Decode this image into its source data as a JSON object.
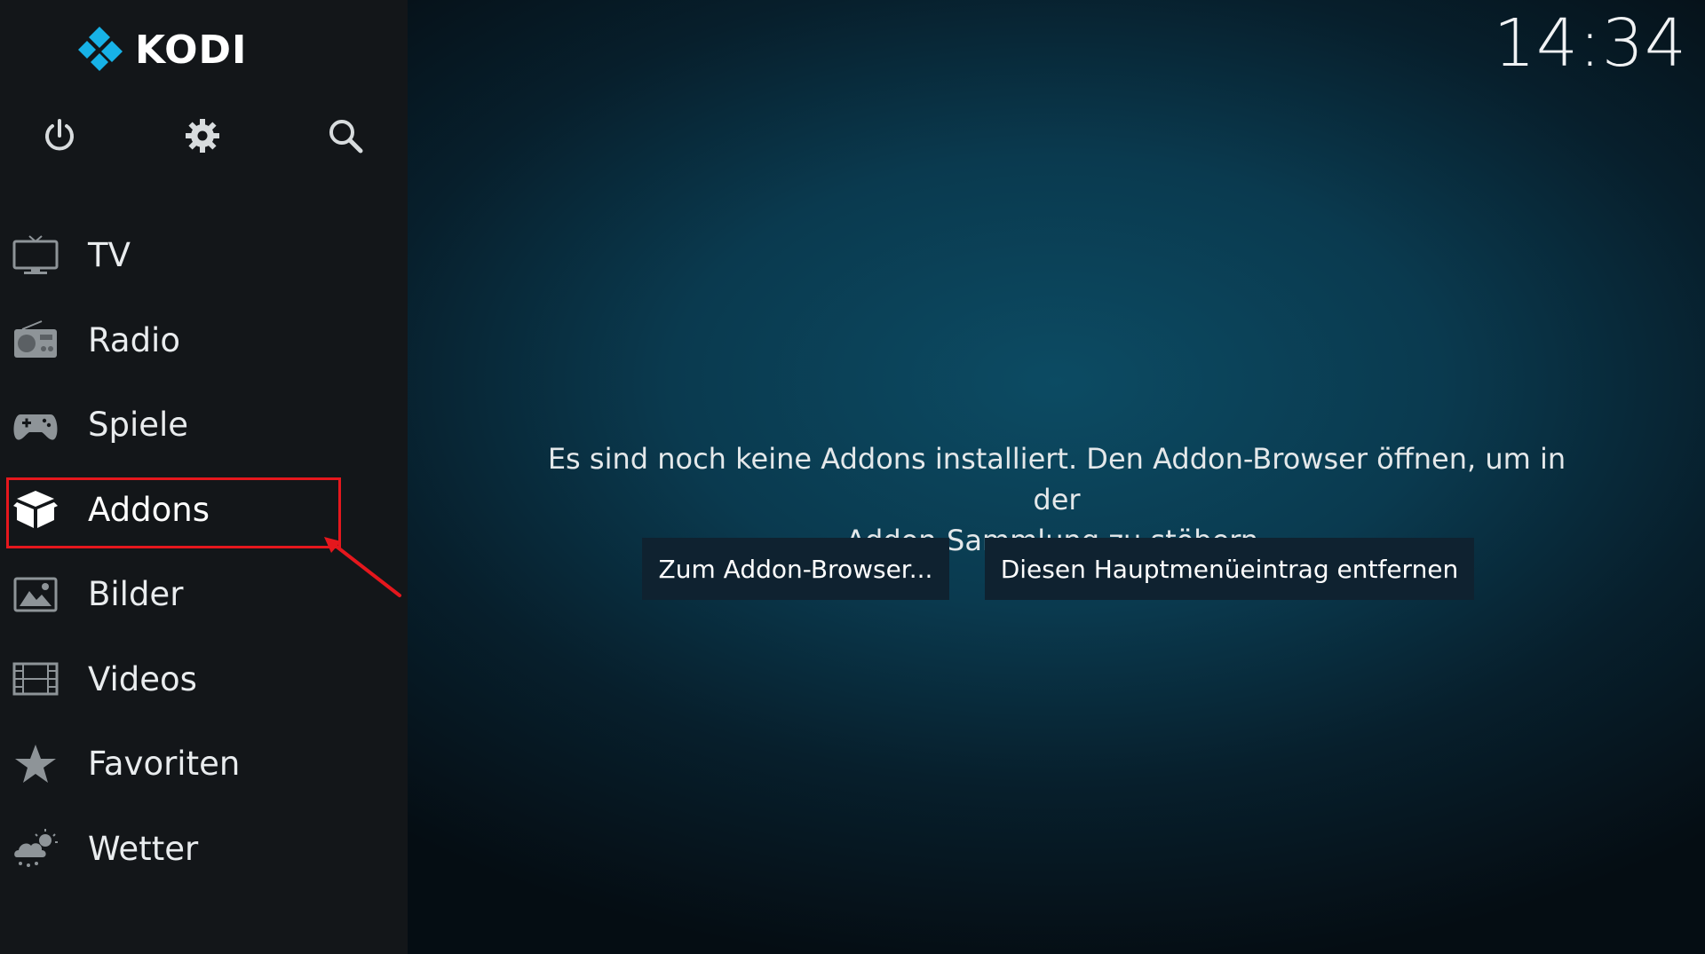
{
  "app": {
    "logo_text": "KODI",
    "clock": "14:34"
  },
  "top_icons": [
    {
      "name": "power-icon"
    },
    {
      "name": "gear-icon"
    },
    {
      "name": "search-icon"
    }
  ],
  "menu": {
    "items": [
      {
        "label": "TV",
        "icon": "tv-icon"
      },
      {
        "label": "Radio",
        "icon": "radio-icon"
      },
      {
        "label": "Spiele",
        "icon": "gamepad-icon"
      },
      {
        "label": "Addons",
        "icon": "addon-box-icon",
        "active": true
      },
      {
        "label": "Bilder",
        "icon": "picture-icon"
      },
      {
        "label": "Videos",
        "icon": "film-icon"
      },
      {
        "label": "Favoriten",
        "icon": "star-icon"
      },
      {
        "label": "Wetter",
        "icon": "weather-icon"
      }
    ]
  },
  "main": {
    "message_line1": "Es sind noch keine Addons installiert. Den Addon-Browser öffnen, um in der",
    "message_line2": "Addon-Sammlung zu stöbern.",
    "buttons": [
      {
        "label": "Zum Addon-Browser..."
      },
      {
        "label": "Diesen Hauptmenüeintrag entfernen"
      }
    ]
  },
  "colors": {
    "sidebar_bg": "#131619",
    "main_bg": "#0a3a4f",
    "button_bg": "#0f2230",
    "annotation_red": "#e5171d",
    "kodi_blue": "#17b2e7"
  }
}
